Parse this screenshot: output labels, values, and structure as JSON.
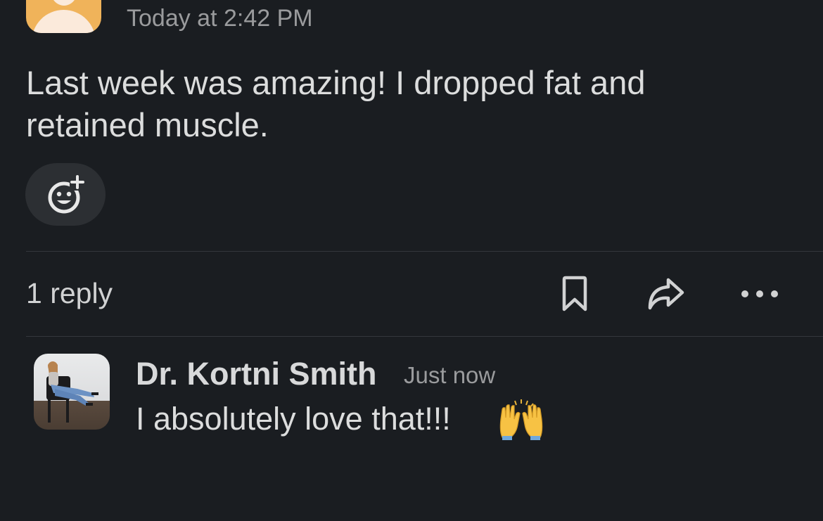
{
  "message": {
    "timestamp": "Today at 2:42 PM",
    "text": "Last week was amazing! I dropped fat and retained muscle.",
    "reactions": []
  },
  "thread": {
    "reply_count_label": "1 reply"
  },
  "actions": {
    "icons": [
      "add-reaction-icon",
      "bookmark-icon",
      "share-icon",
      "more-icon"
    ]
  },
  "reply": {
    "author": "Dr. Kortni Smith",
    "time": "Just now",
    "text": "I absolutely love that!!!",
    "emoji": "raising-hands-emoji"
  },
  "colors": {
    "background": "#1a1d21",
    "text_primary": "#dcdddd",
    "text_secondary": "#9a9b9d",
    "top_avatar": "#f0b35a",
    "reaction_button_bg": "#2c2f33",
    "divider": "#34373c"
  }
}
